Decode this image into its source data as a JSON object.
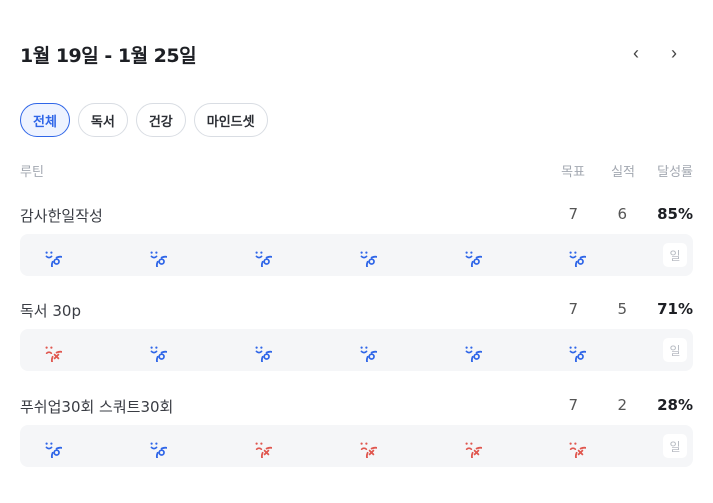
{
  "header": {
    "range_title": "1월 19일 - 1월 25일",
    "prev_icon": "‹",
    "next_icon": "›"
  },
  "filters": [
    {
      "label": "전체",
      "active": true
    },
    {
      "label": "독서",
      "active": false
    },
    {
      "label": "건강",
      "active": false
    },
    {
      "label": "마인드셋",
      "active": false
    }
  ],
  "columns": {
    "routine": "루틴",
    "goal": "목표",
    "actual": "실적",
    "rate": "달성률"
  },
  "colors": {
    "accent": "#2f66e8",
    "success_icon": "#2f66e8",
    "fail_icon": "#e0574f"
  },
  "routines": [
    {
      "name": "감사한일작성",
      "goal": "7",
      "actual": "6",
      "rate": "85%",
      "days": [
        "success-icon",
        "success-icon",
        "success-icon",
        "success-icon",
        "success-icon",
        "success-icon"
      ],
      "sunday_label": "일"
    },
    {
      "name": "독서 30p",
      "goal": "7",
      "actual": "5",
      "rate": "71%",
      "days": [
        "fail-icon",
        "success-icon",
        "success-icon",
        "success-icon",
        "success-icon",
        "success-icon"
      ],
      "sunday_label": "일"
    },
    {
      "name": "푸쉬업30회 스쿼트30회",
      "goal": "7",
      "actual": "2",
      "rate": "28%",
      "days": [
        "success-icon",
        "success-icon",
        "fail-icon",
        "fail-icon",
        "fail-icon",
        "fail-icon"
      ],
      "sunday_label": "일"
    }
  ]
}
